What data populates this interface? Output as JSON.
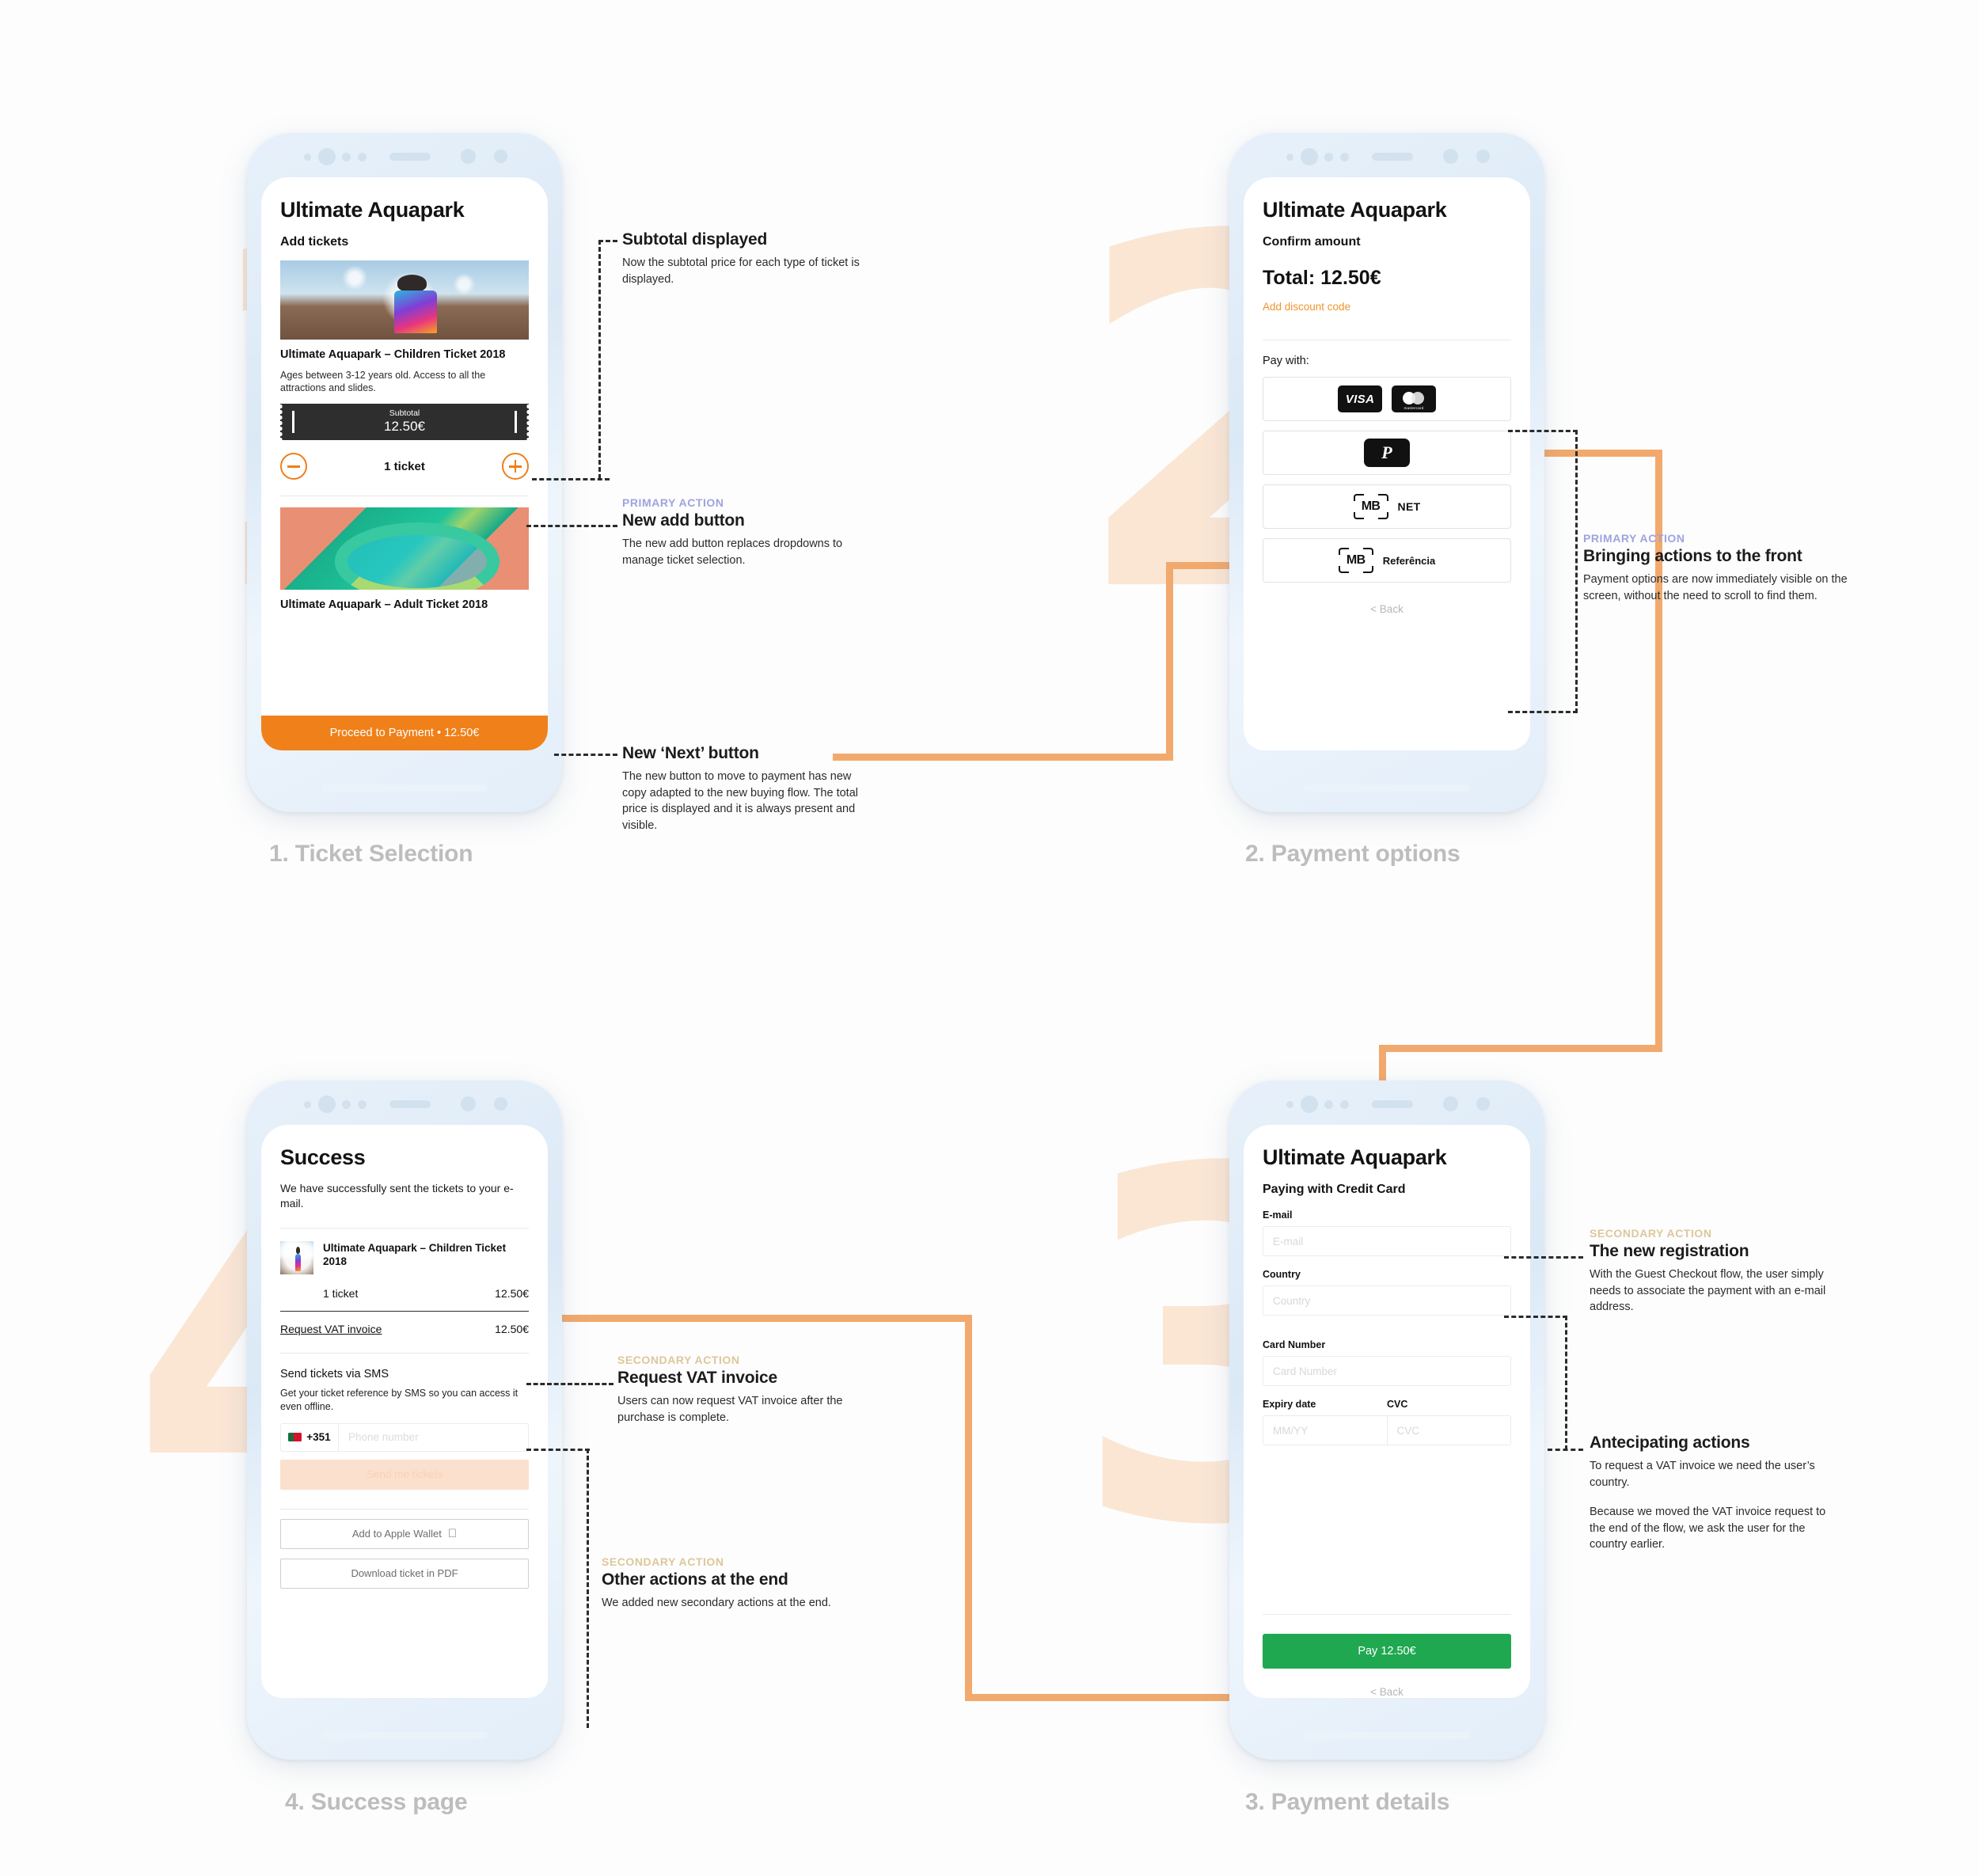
{
  "steps": [
    {
      "id": "s1",
      "caption": "1. Ticket Selection",
      "numeral": "1"
    },
    {
      "id": "s2",
      "caption": "2. Payment options",
      "numeral": "2"
    },
    {
      "id": "s3",
      "caption": "3. Payment details",
      "numeral": "3"
    },
    {
      "id": "s4",
      "caption": "4. Success page",
      "numeral": "4"
    }
  ],
  "kickers": {
    "primary": "PRIMARY ACTION",
    "secondary": "SECONDARY ACTION"
  },
  "colors": {
    "orange": "#f08019",
    "connector": "#f2a96d",
    "green": "#20a851",
    "primary_kicker": "#9fa3e0",
    "secondary_kicker": "#ddc79b",
    "ghost_numeral": "#fbe6d4",
    "caption": "#bdbdbd"
  },
  "screen1": {
    "title": "Ultimate Aquapark",
    "subtitle": "Add tickets",
    "ticket1": {
      "name": "Ultimate Aquapark – Children Ticket 2018",
      "description": "Ages between 3-12 years old. Access to all the attractions and slides.",
      "subtotal_label": "Subtotal",
      "subtotal_value": "12.50€",
      "quantity_label": "1 ticket",
      "minus": "−",
      "plus": "+"
    },
    "ticket2": {
      "name": "Ultimate Aquapark – Adult Ticket 2018"
    },
    "cta": "Proceed to Payment • 12.50€"
  },
  "screen2": {
    "title": "Ultimate Aquapark",
    "subtitle": "Confirm amount",
    "total": "Total: 12.50€",
    "discount_link": "Add discount code",
    "pay_with_label": "Pay with:",
    "options": [
      {
        "id": "card",
        "labels": [
          "VISA",
          "mastercard"
        ]
      },
      {
        "id": "paypal",
        "labels": [
          "P"
        ]
      },
      {
        "id": "mbnet",
        "mark": "MB",
        "label": "NET"
      },
      {
        "id": "mbref",
        "mark": "MB",
        "label": "Referência"
      }
    ],
    "back": "< Back"
  },
  "screen3": {
    "title": "Ultimate Aquapark",
    "subtitle": "Paying with Credit Card",
    "fields": [
      {
        "label": "E-mail",
        "placeholder": "E-mail"
      },
      {
        "label": "Country",
        "placeholder": "Country"
      },
      {
        "label": "Card Number",
        "placeholder": "Card Number"
      }
    ],
    "expiry": {
      "label": "Expiry date",
      "placeholder": "MM/YY"
    },
    "cvc": {
      "label": "CVC",
      "placeholder": "CVC"
    },
    "pay_button": "Pay 12.50€",
    "back": "< Back"
  },
  "screen4": {
    "title": "Success",
    "message": "We have successfully sent the tickets to your e-mail.",
    "item_name": "Ultimate Aquapark – Children Ticket 2018",
    "qty_label": "1 ticket",
    "qty_price": "12.50€",
    "vat_link": "Request VAT invoice",
    "vat_price": "12.50€",
    "sms_heading": "Send tickets via SMS",
    "sms_body": "Get your ticket reference by SMS so you can access it even offline.",
    "country_code": "+351",
    "phone_placeholder": "Phone number",
    "send_button": "Send me tickets",
    "wallet_button": "Add to Apple Wallet",
    "pdf_button": "Download ticket in PDF"
  },
  "callouts": {
    "subtotal": {
      "title": "Subtotal displayed",
      "body": "Now the subtotal price for each type of ticket is displayed."
    },
    "add_button": {
      "kicker": "PRIMARY ACTION",
      "title": "New add button",
      "body": "The new add button replaces dropdowns to manage ticket selection."
    },
    "next_button": {
      "title": "New ‘Next’ button",
      "body": "The new button to move to payment has new copy adapted to the new buying flow. The total price is displayed and it is always present and visible."
    },
    "front_actions": {
      "kicker": "PRIMARY ACTION",
      "title": "Bringing actions to the front",
      "body": "Payment options are now immediately visible on the screen, without the need to scroll to find them."
    },
    "registration": {
      "kicker": "SECONDARY ACTION",
      "title": "The new registration",
      "body": "With the Guest Checkout flow, the user simply needs to associate the payment with an e-mail address."
    },
    "anticipating": {
      "title": "Antecipating actions",
      "body1": "To request a VAT invoice we need the user’s country.",
      "body2": "Because we moved the VAT invoice request to the end of the flow, we ask the user for the country earlier."
    },
    "vat_invoice": {
      "kicker": "SECONDARY ACTION",
      "title": "Request VAT invoice",
      "body": "Users can now request VAT invoice after the purchase is complete."
    },
    "other_actions": {
      "kicker": "SECONDARY ACTION",
      "title": "Other actions at the end",
      "body": "We added new secondary actions at the end."
    }
  }
}
